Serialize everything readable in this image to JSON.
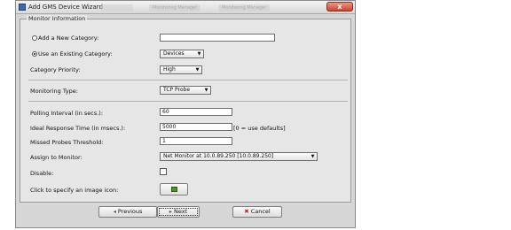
{
  "window": {
    "title": "Add GMS Device Wizard",
    "close_glyph": "x",
    "background_tabs": [
      "",
      "Monitoring Manager",
      "Monitoring Manager"
    ]
  },
  "panel": {
    "title": "Monitor Information"
  },
  "category": {
    "add_new_label": "Add a New Category:",
    "add_new_value": "",
    "use_existing_label": "Use an Existing Category:",
    "use_existing_value": "Devices",
    "priority_label": "Category Priority:",
    "priority_value": "High"
  },
  "monitoring": {
    "type_label": "Monitoring Type:",
    "type_value": "TCP Probe"
  },
  "polling": {
    "interval_label": "Polling Interval (in secs.):",
    "interval_value": "60",
    "response_label": "Ideal Response Time (in msecs.):",
    "response_value": "5000",
    "response_hint": "[0 = use defaults]",
    "missed_label": "Missed Probes Threshold:",
    "missed_value": "1"
  },
  "assign": {
    "label": "Assign to Monitor:",
    "value": "Net Monitor at 10.0.89.250 [10.0.89.250]"
  },
  "disable": {
    "label": "Disable:"
  },
  "image_icon": {
    "label": "Click to specify an image icon:"
  },
  "footer": {
    "previous": "Previous",
    "next": "Next",
    "cancel": "Cancel"
  },
  "icons": {
    "arrow": "chevron-down-icon",
    "prev": "chevron-left-icon",
    "next": "chevron-right-icon",
    "cancel": "cancel-icon"
  }
}
